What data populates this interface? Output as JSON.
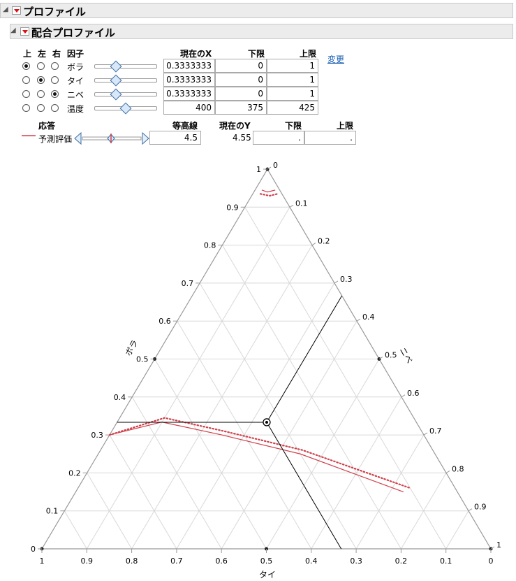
{
  "outline": {
    "title": "プロファイル"
  },
  "profiler": {
    "title": "配合プロファイル",
    "factor_headers": {
      "top": "上",
      "left": "左",
      "right": "右",
      "factor": "因子",
      "current_x": "現在のX",
      "lower": "下限",
      "upper": "上限"
    },
    "change_link": "変更",
    "factors": [
      {
        "name": "ボラ",
        "current": "0.3333333",
        "lower": "0",
        "upper": "1",
        "radio": "top",
        "slider": 0.3333
      },
      {
        "name": "タイ",
        "current": "0.3333333",
        "lower": "0",
        "upper": "1",
        "radio": "left",
        "slider": 0.3333
      },
      {
        "name": "ニベ",
        "current": "0.3333333",
        "lower": "0",
        "upper": "1",
        "radio": "right",
        "slider": 0.3333
      },
      {
        "name": "温度",
        "current": "400",
        "lower": "375",
        "upper": "425",
        "radio": "none",
        "slider": 0.5
      }
    ],
    "response_headers": {
      "response": "応答",
      "contour": "等高線",
      "current_y": "現在のY",
      "lower": "下限",
      "upper": "上限"
    },
    "response": {
      "name": "予測評価",
      "contour": "4.5",
      "current_y": "4.55",
      "lower": ".",
      "upper": ".",
      "color": "#d0404a"
    }
  },
  "chart_data": {
    "type": "ternary-contour",
    "vertex_top": "ボラ",
    "vertex_left": "タイ",
    "vertex_right": "ニベ",
    "ticks": [
      "0",
      "0.1",
      "0.2",
      "0.3",
      "0.4",
      "0.5",
      "0.6",
      "0.7",
      "0.8",
      "0.9",
      "1"
    ],
    "current_point": {
      "bora": 0.3333,
      "tai": 0.3333,
      "nibe": 0.3333
    },
    "contour_level": 4.5,
    "contour_curves": [
      {
        "style": "solid",
        "points": [
          [
            0.3,
            0.7,
            0.0
          ],
          [
            0.333,
            0.566,
            0.1
          ],
          [
            0.3,
            0.45,
            0.25
          ],
          [
            0.25,
            0.3,
            0.45
          ],
          [
            0.15,
            0.12,
            0.73
          ]
        ]
      },
      {
        "style": "dotted",
        "points": [
          [
            0.3,
            0.7,
            0.0
          ],
          [
            0.345,
            0.555,
            0.1
          ],
          [
            0.31,
            0.44,
            0.25
          ],
          [
            0.26,
            0.29,
            0.45
          ],
          [
            0.16,
            0.1,
            0.74
          ]
        ]
      },
      {
        "style": "solid",
        "points": [
          [
            0.945,
            0.04,
            0.015
          ],
          [
            0.94,
            0.03,
            0.03
          ],
          [
            0.945,
            0.01,
            0.045
          ]
        ]
      },
      {
        "style": "dotted",
        "points": [
          [
            0.935,
            0.048,
            0.017
          ],
          [
            0.93,
            0.03,
            0.04
          ],
          [
            0.935,
            0.01,
            0.055
          ]
        ]
      }
    ],
    "colors": {
      "contour": "#d0404a",
      "grid": "#d8d8d8",
      "frame": "#999999",
      "crosshair": "#000000"
    }
  }
}
